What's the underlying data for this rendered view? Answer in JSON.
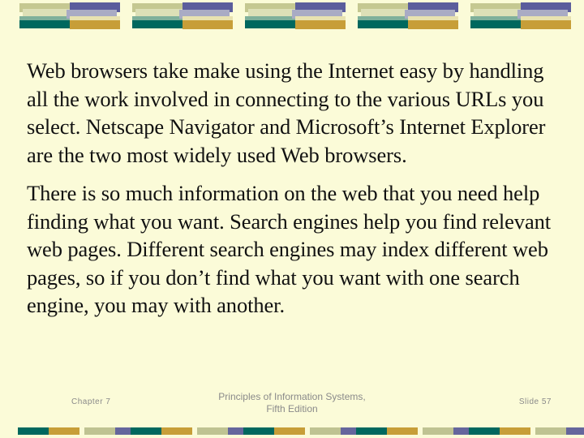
{
  "slide": {
    "background_color": "#fbfbd8",
    "body": {
      "paragraphs": [
        "Web browsers take make using the Internet easy by handling all the work involved in connecting to the various URLs you select.  Netscape Navigator and Microsoft’s Internet Explorer are the two most widely used Web browsers.",
        "There is so much information on the web that you need help finding what you want.  Search engines help you find relevant web pages.  Different search engines may index different web pages, so if you don’t find what you want with one search engine, you may with another."
      ]
    },
    "footer": {
      "chapter": "Chapter  7",
      "title_line1": "Principles of Information Systems,",
      "title_line2": "Fifth Edition",
      "slide_number": "Slide 57",
      "text_color": "#8a8a8a"
    },
    "decoration": {
      "top_band": {
        "unit_count": 5,
        "colors": {
          "sage": "#c5c891",
          "pale": "#dde0b7",
          "green": "#7fb09b",
          "teal": "#00685e",
          "purple": "#5b5d9c",
          "lavender": "#a9abc4",
          "cream": "#e8e2b0",
          "gold": "#c79e38"
        }
      },
      "bottom_band": {
        "unit_count": 5,
        "colors": {
          "teal": "#00685e",
          "gold": "#c79e38",
          "sage": "#bfc392",
          "purple": "#65669c"
        }
      }
    }
  }
}
